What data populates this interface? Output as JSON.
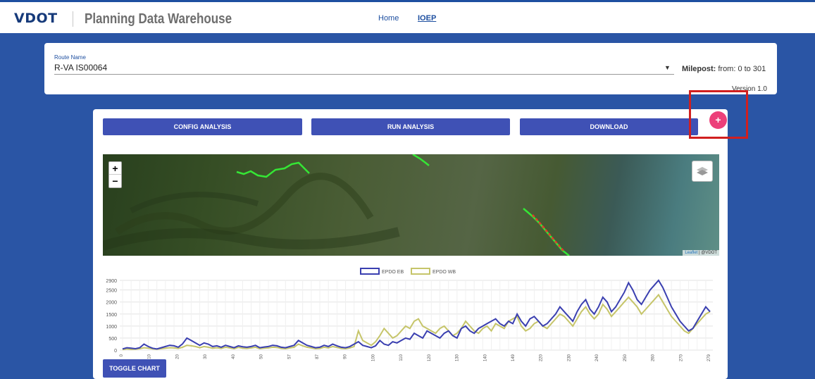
{
  "header": {
    "logo_text": "VDOT",
    "app_title": "Planning Data Warehouse",
    "nav": [
      "Home",
      "IOEP"
    ],
    "active_nav": "IOEP"
  },
  "route": {
    "label": "Route Name",
    "value": "R-VA IS00064",
    "milepost_label": "Milepost:",
    "milepost_value": "from: 0 to 301",
    "version": "Version 1.0"
  },
  "actions": {
    "config": "CONFIG ANALYSIS",
    "run": "RUN ANALYSIS",
    "download": "DOWNLOAD",
    "fab": "+",
    "toggle_chart": "TOGGLE CHART"
  },
  "map": {
    "zoom_in": "+",
    "zoom_out": "−",
    "attribution_link": "Leaflet",
    "attribution_text": "| @VDOT"
  },
  "colors": {
    "accent": "#3f51b5",
    "fab": "#ec407a",
    "highlight": "#d11f1f",
    "series_eb": "#3a3fb0",
    "series_wb": "#c6c56a"
  },
  "chart_data": {
    "type": "line",
    "ylim": [
      0,
      2900
    ],
    "yticks": [
      0,
      500,
      1000,
      1500,
      2000,
      2500,
      2900
    ],
    "xticks": [
      "0",
      "10",
      "20",
      "30",
      "40",
      "50",
      "57",
      "87",
      "90",
      "100",
      "110",
      "120",
      "130",
      "140",
      "149",
      "220",
      "230",
      "240",
      "250",
      "260",
      "270",
      "279"
    ],
    "grid": true,
    "legend_position": "top-center",
    "series": [
      {
        "name": "EPDO EB",
        "values": [
          50,
          100,
          80,
          60,
          100,
          250,
          150,
          80,
          50,
          100,
          150,
          200,
          180,
          120,
          260,
          500,
          400,
          300,
          200,
          300,
          250,
          150,
          180,
          120,
          200,
          150,
          100,
          180,
          140,
          120,
          150,
          200,
          100,
          130,
          150,
          200,
          180,
          120,
          100,
          150,
          200,
          400,
          300,
          200,
          150,
          100,
          120,
          200,
          150,
          250,
          180,
          120,
          100,
          150,
          250,
          350,
          200,
          150,
          100,
          180,
          400,
          250,
          200,
          350,
          300,
          400,
          500,
          450,
          700,
          600,
          500,
          800,
          700,
          600,
          500,
          700,
          800,
          600,
          500,
          900,
          1000,
          800,
          700,
          900,
          1000,
          1100,
          1200,
          1300,
          1100,
          1000,
          1200,
          1100,
          1500,
          1200,
          1000,
          1300,
          1400,
          1200,
          1000,
          1100,
          1300,
          1500,
          1800,
          1600,
          1400,
          1200,
          1600,
          1900,
          2100,
          1700,
          1500,
          1800,
          2200,
          2000,
          1600,
          1800,
          2100,
          2400,
          2800,
          2500,
          2100,
          1900,
          2200,
          2500,
          2700,
          2900,
          2600,
          2200,
          1800,
          1500,
          1200,
          1000,
          800,
          900,
          1200,
          1500,
          1800,
          1600
        ],
        "color": "#3a3fb0"
      },
      {
        "name": "EPDO WB",
        "values": [
          20,
          50,
          30,
          40,
          60,
          100,
          80,
          50,
          40,
          60,
          80,
          100,
          90,
          70,
          120,
          200,
          180,
          150,
          100,
          150,
          120,
          80,
          100,
          70,
          120,
          90,
          60,
          110,
          80,
          70,
          90,
          120,
          60,
          80,
          90,
          120,
          110,
          70,
          60,
          90,
          120,
          250,
          180,
          120,
          90,
          60,
          70,
          120,
          90,
          150,
          110,
          70,
          60,
          90,
          150,
          800,
          400,
          300,
          200,
          350,
          600,
          900,
          700,
          500,
          600,
          800,
          1000,
          900,
          1200,
          1300,
          1000,
          900,
          800,
          700,
          900,
          1000,
          800,
          600,
          700,
          900,
          1200,
          1000,
          800,
          700,
          900,
          1000,
          800,
          1100,
          1000,
          900,
          1200,
          1300,
          1400,
          1000,
          800,
          900,
          1100,
          1200,
          1000,
          900,
          1100,
          1300,
          1500,
          1400,
          1200,
          1000,
          1300,
          1600,
          1800,
          1500,
          1300,
          1500,
          1900,
          1700,
          1400,
          1600,
          1800,
          2000,
          2200,
          2000,
          1800,
          1500,
          1700,
          1900,
          2100,
          2300,
          2000,
          1700,
          1400,
          1200,
          1000,
          800,
          700,
          900,
          1100,
          1300,
          1500,
          1600
        ],
        "color": "#c6c56a"
      }
    ]
  }
}
